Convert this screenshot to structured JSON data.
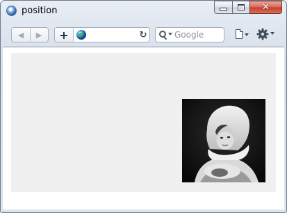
{
  "window": {
    "title": "position",
    "icon": "browser-icon",
    "caption_buttons": [
      "minimize-icon",
      "maximize-icon",
      "close-icon"
    ]
  },
  "toolbar": {
    "back_icon": "back-arrow-icon",
    "forward_icon": "forward-arrow-icon",
    "add_icon": "plus-icon",
    "address": {
      "value": "",
      "site_icon": "globe-icon"
    },
    "reload_icon": "reload-icon",
    "search": {
      "placeholder": "Google",
      "value": "",
      "icon": "search-icon"
    },
    "page_menu_icon": "page-icon",
    "tools_menu_icon": "gear-icon"
  },
  "page": {
    "box_background": "#f0f0f0",
    "image": {
      "description": "portrait-photo",
      "tone": "grayscale"
    }
  },
  "colors": {
    "chrome": "#dde3ec",
    "close_button": "#c9463a"
  }
}
